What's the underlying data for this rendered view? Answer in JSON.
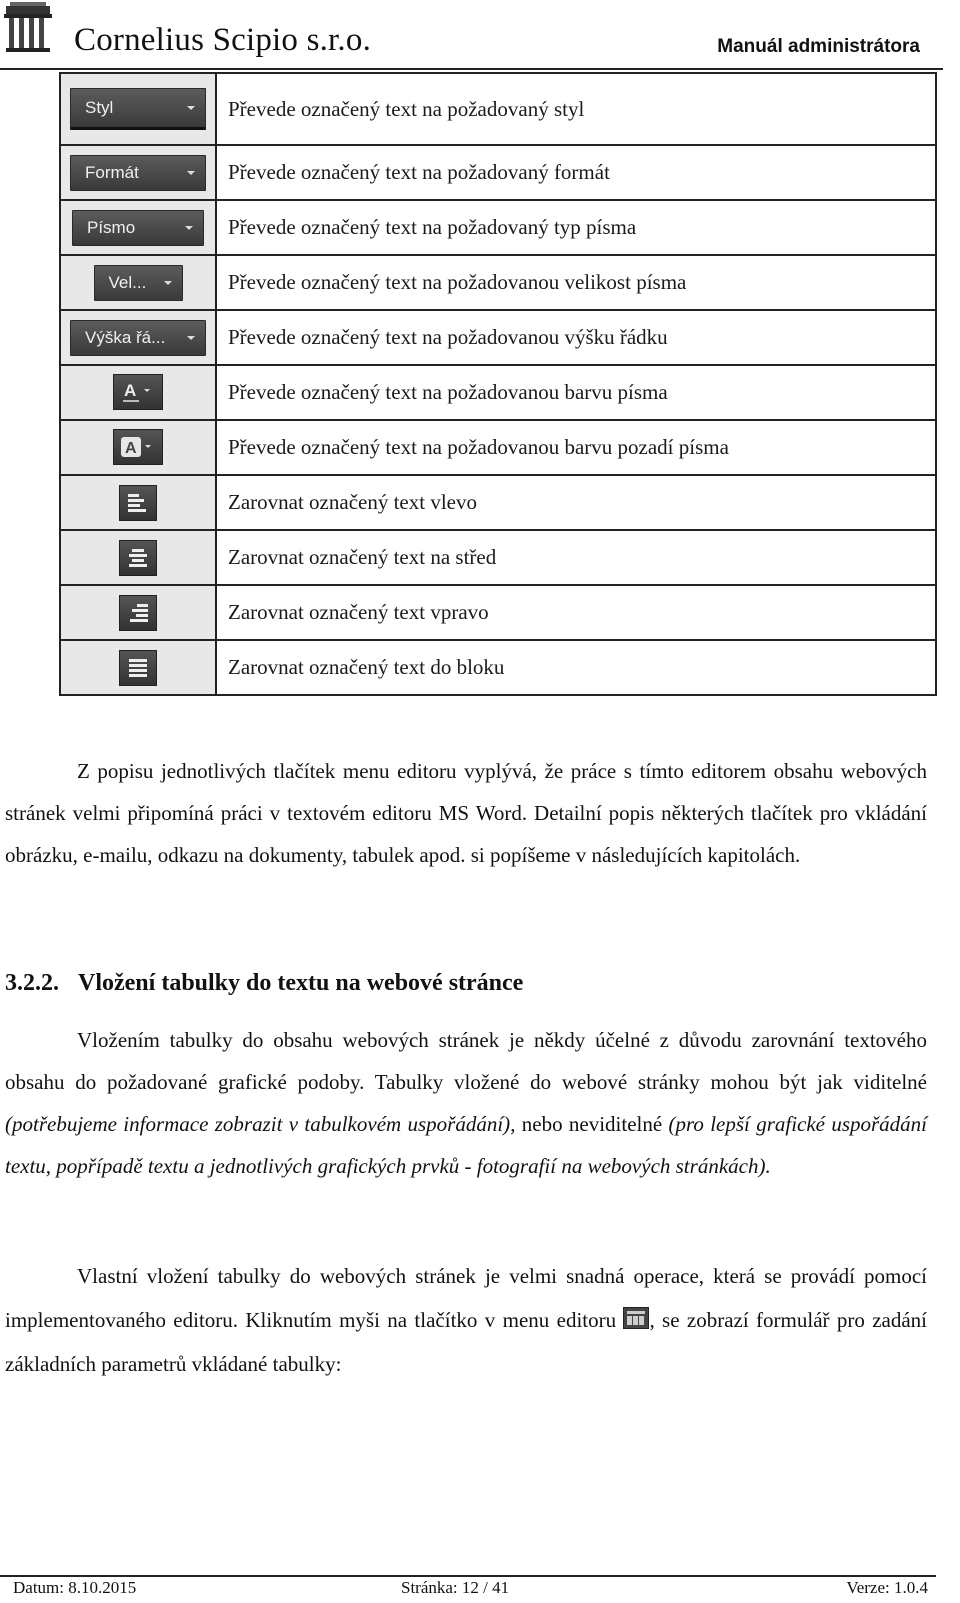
{
  "header": {
    "logo_icon": "building-columns-icon",
    "company": "Cornelius Scipio s.r.o.",
    "manual_title": "Manuál administrátora"
  },
  "toolbar_table": {
    "rows": [
      {
        "control": "Styl",
        "control_type": "dropdown",
        "description": "Převede označený text na požadovaný styl"
      },
      {
        "control": "Formát",
        "control_type": "dropdown",
        "description": "Převede označený text na požadovaný formát"
      },
      {
        "control": "Písmo",
        "control_type": "dropdown",
        "description": "Převede označený text na požadovaný typ písma"
      },
      {
        "control": "Vel...",
        "control_type": "dropdown",
        "description": "Převede označený text na požadovanou velikost písma"
      },
      {
        "control": "Výška řá...",
        "control_type": "dropdown",
        "description": "Převede označený text na požadovanou výšku řádku"
      },
      {
        "control": "A",
        "control_type": "font-color-icon",
        "description": "Převede označený text na požadovanou barvu písma"
      },
      {
        "control": "A",
        "control_type": "background-color-icon",
        "description": "Převede označený text na požadovanou barvu pozadí písma"
      },
      {
        "control": "",
        "control_type": "align-left-icon",
        "description": "Zarovnat označený text vlevo"
      },
      {
        "control": "",
        "control_type": "align-center-icon",
        "description": "Zarovnat označený text na střed"
      },
      {
        "control": "",
        "control_type": "align-right-icon",
        "description": "Zarovnat označený text vpravo"
      },
      {
        "control": "",
        "control_type": "align-justify-icon",
        "description": "Zarovnat označený text do bloku"
      }
    ]
  },
  "paragraph1": "Z popisu jednotlivých tlačítek menu editoru vyplývá, že práce s tímto editorem obsahu webových stránek velmi připomíná práci v textovém editoru MS Word. Detailní popis některých tlačítek pro vkládání obrázku, e-mailu, odkazu na dokumenty, tabulek apod. si popíšeme v následujících kapitolách.",
  "section": {
    "number": "3.2.2.",
    "title": "Vložení tabulky do textu na webové stránce"
  },
  "paragraph2": {
    "part1": "Vložením tabulky do obsahu webových stránek je někdy účelné z důvodu zarovnání textového obsahu do požadované grafické podoby. Tabulky vložené do webové stránky mohou být jak viditelné ",
    "italic1": "(potřebujeme informace zobrazit v tabulkovém uspořádání)",
    "part2": ", nebo neviditelné ",
    "italic2": "(pro lepší grafické uspořádání textu, popřípadě textu a jednotlivých grafických prvků - fotografií na webových stránkách).",
    "part3": ""
  },
  "paragraph3": {
    "before_icon": "Vlastní vložení tabulky do webových stránek je velmi snadná operace, která se provádí pomocí implementovaného editoru. Kliknutím myši na tlačítko v menu editoru ",
    "icon": "insert-table-icon",
    "after_icon": ", se zobrazí formulář pro zadání základních parametrů vkládané tabulky:"
  },
  "footer": {
    "date": "Datum: 8.10.2015",
    "page": "Stránka: 12 / 41",
    "version": "Verze: 1.0.4"
  }
}
